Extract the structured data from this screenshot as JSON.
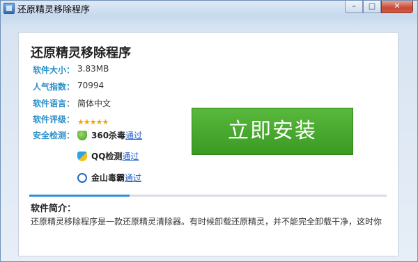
{
  "window": {
    "title": "还原精灵移除程序",
    "min_label": "–",
    "max_label": "□",
    "close_label": "✕"
  },
  "app": {
    "name": "还原精灵移除程序",
    "info": [
      {
        "label": "软件大小：",
        "value": "3.83MB"
      },
      {
        "label": "人气指数：",
        "value": "70994"
      },
      {
        "label": "软件语言：",
        "value": "简体中文"
      },
      {
        "label": "软件评级：",
        "value": ""
      },
      {
        "label": "安全检测：",
        "value": ""
      }
    ],
    "rating_stars": 5,
    "security": [
      {
        "name": "360杀毒",
        "status": "通过",
        "icon": "360-shield-icon"
      },
      {
        "name": "QQ检测",
        "status": "通过",
        "icon": "qq-shield-icon"
      },
      {
        "name": "金山毒霸",
        "status": "通过",
        "icon": "kingsoft-icon"
      }
    ]
  },
  "install": {
    "label": "立即安装"
  },
  "progress": {
    "value": 0.28
  },
  "intro": {
    "title": "软件简介：",
    "text": "还原精灵移除程序是一款还原精灵清除器。有时候卸载还原精灵，并不能完全卸载干净，这时你"
  },
  "colors": {
    "accent": "#2b90c9",
    "install_green": "#46a82c",
    "link_blue": "#1f5ec9",
    "star": "#f0a500"
  }
}
